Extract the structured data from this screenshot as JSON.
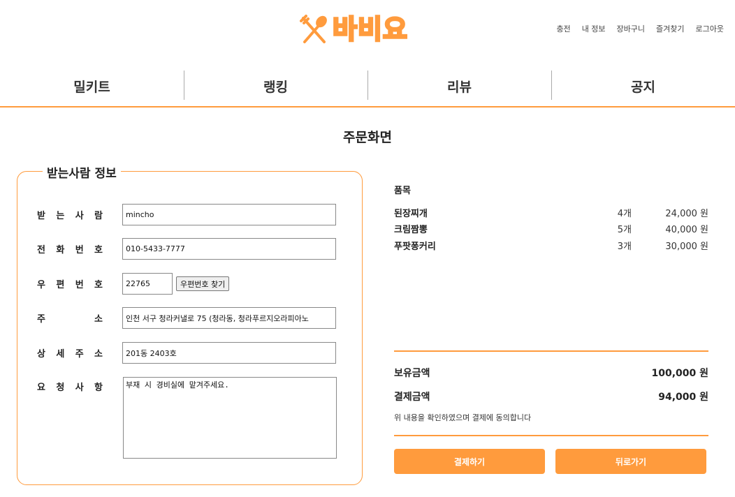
{
  "brand": {
    "logo_text": "바비요",
    "accent_color": "#ff9b3d",
    "logo_icon": "fork-spoon-icon"
  },
  "top_links": [
    "충전",
    "내 정보",
    "장바구니",
    "즐겨찾기",
    "로그아웃"
  ],
  "nav": [
    "밀키트",
    "랭킹",
    "리뷰",
    "공지"
  ],
  "page_title": "주문화면",
  "recipient": {
    "legend": "받는사람 정보",
    "name_label": [
      "받",
      "는",
      "사",
      "람"
    ],
    "name_value": "mincho",
    "phone_label": [
      "전",
      "화",
      "번",
      "호"
    ],
    "phone_value": "010-5433-7777",
    "zip_label": [
      "우",
      "편",
      "번",
      "호"
    ],
    "zip_value": "22765",
    "zip_button": "우편번호 찾기",
    "address_label": [
      "주",
      "소"
    ],
    "address_value": "인천 서구 청라커낼로 75 (청라동, 청라푸르지오라피아노",
    "detail_label": [
      "상",
      "세",
      "주",
      "소"
    ],
    "detail_value": "201동 2403호",
    "request_label": [
      "요",
      "청",
      "사",
      "항"
    ],
    "request_value": "부재 시 경비실에 맡겨주세요."
  },
  "order": {
    "items_header": "품목",
    "items": [
      {
        "name": "된장찌개",
        "qty": "4개",
        "price": "24,000 원"
      },
      {
        "name": "크림짬뽕",
        "qty": "5개",
        "price": "40,000 원"
      },
      {
        "name": "푸팟퐁커리",
        "qty": "3개",
        "price": "30,000 원"
      }
    ],
    "balance_label": "보유금액",
    "balance_value": "100,000 원",
    "payment_label": "결제금액",
    "payment_value": "94,000 원",
    "agree_text": "위 내용을 확인하였으며 결제에 동의합니다",
    "pay_button": "결제하기",
    "back_button": "뒤로가기"
  }
}
